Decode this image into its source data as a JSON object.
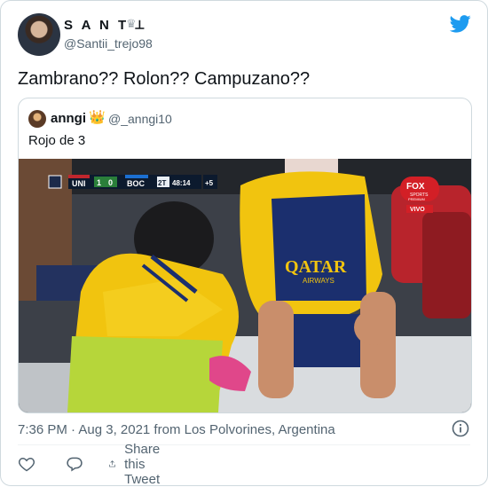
{
  "author": {
    "display_name": "S A N T ⟂",
    "handle": "@Santii_trejo98"
  },
  "tweet": {
    "text": "Zambrano?? Rolon?? Campuzano??"
  },
  "quoted": {
    "name": "anngi",
    "crown": "👑",
    "handle": "@_anngi10",
    "text": "Rojo de 3",
    "photo": {
      "scoreboard": {
        "home": "UNI",
        "home_score": "1",
        "away_score": "0",
        "away": "BOC",
        "period": "2T",
        "clock": "48:14",
        "added": "+5"
      },
      "broadcaster": "FOX",
      "broadcaster_sub": "SPORTS",
      "broadcaster_tag": "PREMIUM",
      "live": "VIVO",
      "jersey_sponsor": "QATAR",
      "jersey_sponsor_sub": "AIRWAYS"
    }
  },
  "meta": {
    "timestamp": "7:36 PM · Aug 3, 2021 from Los Polvorines, Argentina"
  },
  "actions": {
    "share_label": "Share this Tweet"
  },
  "colors": {
    "twitter_blue": "#1d9bf0",
    "boca_blue": "#1b2f6e",
    "boca_yellow": "#f1c40f",
    "bib_green": "#b6d63a"
  }
}
